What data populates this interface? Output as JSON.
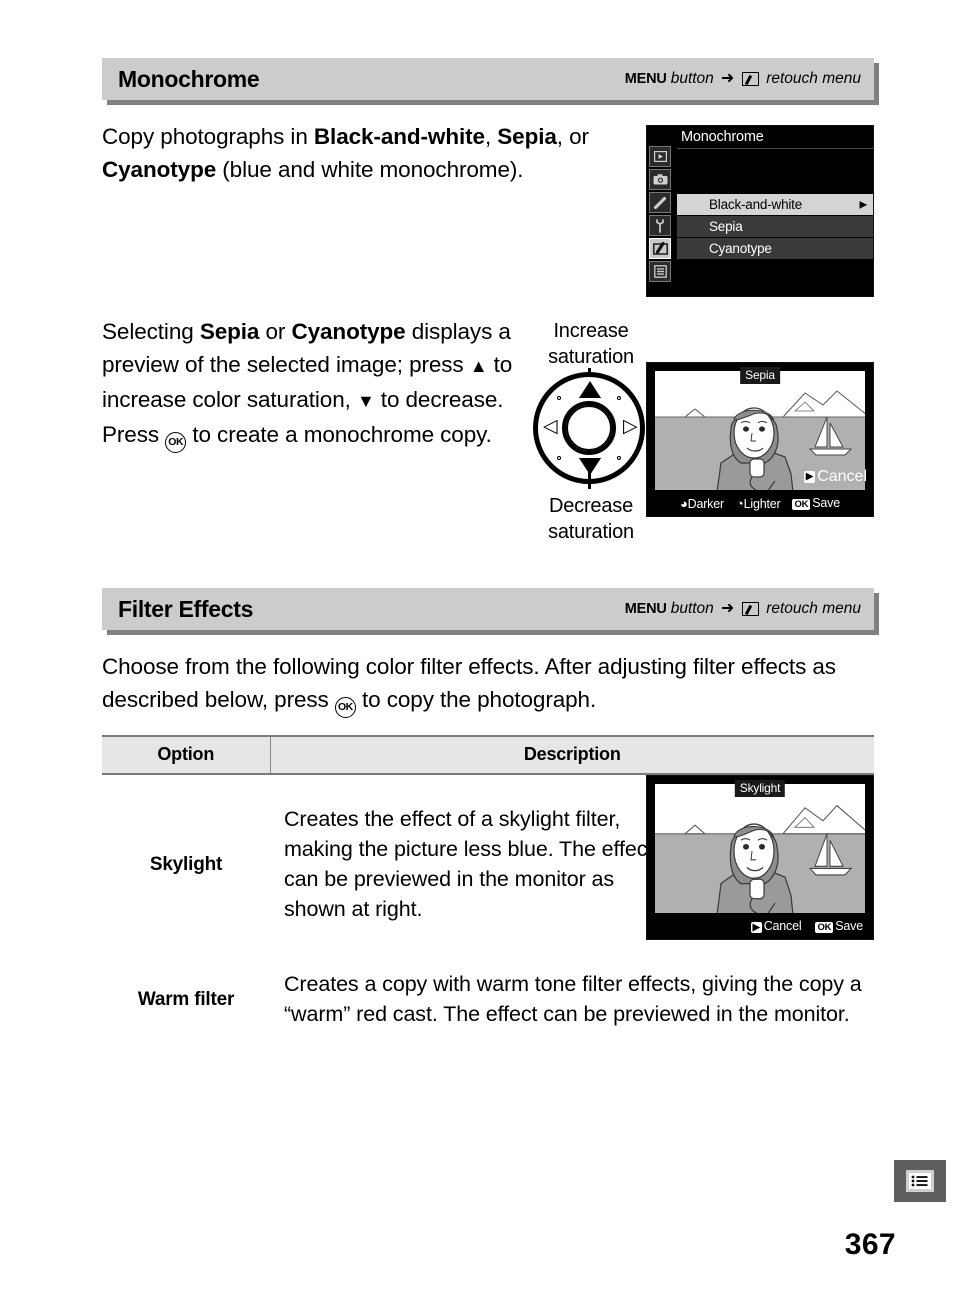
{
  "page": {
    "number": "367",
    "tab_icon": "menu-list-icon"
  },
  "sections": [
    {
      "id": "monochrome",
      "title": "Monochrome",
      "path": {
        "menu_word": "MENU",
        "button_word": "button",
        "arrow": "➜",
        "icon": "retouch-menu-icon",
        "destination": "retouch menu"
      },
      "paragraphs": [
        {
          "id": "intro",
          "runs": [
            {
              "text": "Copy photographs in ",
              "bold": false
            },
            {
              "text": "Black-and-white",
              "bold": true
            },
            {
              "text": ", ",
              "bold": false
            },
            {
              "text": "Sepia",
              "bold": true
            },
            {
              "text": ", or ",
              "bold": false
            },
            {
              "text": "Cyanotype",
              "bold": true
            },
            {
              "text": " (blue and white monochrome).",
              "bold": false
            }
          ]
        },
        {
          "id": "selecting",
          "runs": [
            {
              "text": "Selecting ",
              "bold": false
            },
            {
              "text": "Sepia",
              "bold": true
            },
            {
              "text": " or ",
              "bold": false
            },
            {
              "text": "Cyanotype",
              "bold": true
            },
            {
              "text": " displays a preview of the selected image; press ",
              "bold": false
            },
            {
              "text": "▲",
              "bold": false,
              "glyph": "triangle-up"
            },
            {
              "text": " to increase color saturation, ",
              "bold": false
            },
            {
              "text": "▼",
              "bold": false,
              "glyph": "triangle-down"
            },
            {
              "text": " to decrease.  Press ",
              "bold": false
            },
            {
              "text": "OK",
              "bold": false,
              "glyph": "ok-button"
            },
            {
              "text": " to create a monochrome copy.",
              "bold": false
            }
          ]
        }
      ]
    },
    {
      "id": "filter-effects",
      "title": "Filter Effects",
      "path": {
        "menu_word": "MENU",
        "button_word": "button",
        "arrow": "➜",
        "icon": "retouch-menu-icon",
        "destination": "retouch menu"
      },
      "intro_text_1": "Choose from the following color filter effects.  After adjusting filter",
      "intro_text_2a": "effects as described below, press ",
      "intro_text_2b": " to copy the photograph."
    }
  ],
  "menu_screen": {
    "title": "Monochrome",
    "sidebar_icons": [
      "playback-icon",
      "shooting-camera-icon",
      "custom-settings-pencil-icon",
      "setup-wrench-icon",
      "retouch-menu-icon",
      "recent-settings-icon"
    ],
    "selected_sidebar_index": 4,
    "items": [
      {
        "label": "Black-and-white",
        "highlighted": true,
        "chevron": "▶"
      },
      {
        "label": "Sepia",
        "highlighted": false,
        "chevron": ""
      },
      {
        "label": "Cyanotype",
        "highlighted": false,
        "chevron": ""
      }
    ]
  },
  "sepia_preview": {
    "tag": "Sepia",
    "cancel_label": "Cancel",
    "cancel_chip": "▶",
    "footer": [
      {
        "chip": "dial-main",
        "label": "Darker"
      },
      {
        "chip": "dial-sub",
        "label": "Lighter"
      },
      {
        "chip": "OK",
        "label": "Save"
      }
    ]
  },
  "skylight_preview": {
    "tag": "Skylight",
    "footer": [
      {
        "chip": "▶",
        "label": "Cancel"
      },
      {
        "chip": "OK",
        "label": "Save"
      }
    ]
  },
  "multi_selector": {
    "caption_top_line1": "Increase",
    "caption_top_line2": "saturation",
    "caption_bottom_line1": "Decrease",
    "caption_bottom_line2": "saturation",
    "up_arrow": "▲",
    "down_arrow": "▼",
    "left_arrow": "◁",
    "right_arrow": "▷"
  },
  "table": {
    "headers": [
      "Option",
      "Description"
    ],
    "rows": [
      {
        "option": "Skylight",
        "description": "Creates the effect of a skylight filter, making the picture less blue.  The effect can be previewed in the monitor as shown at right.",
        "has_image": true
      },
      {
        "option": "Warm filter",
        "description": "Creates a copy with warm tone filter effects, giving the copy a “warm” red cast.  The effect can be previewed in the monitor.",
        "has_image": false
      }
    ]
  },
  "colors": {
    "header_bar": "#cccccc",
    "header_shadow": "#808080",
    "table_header_bg": "#e6e6e6",
    "rule": "#7a7a7a",
    "lcd_black": "#000000",
    "highlight_row": "#d4d4d4",
    "page_tab": "#5e5e5e"
  }
}
